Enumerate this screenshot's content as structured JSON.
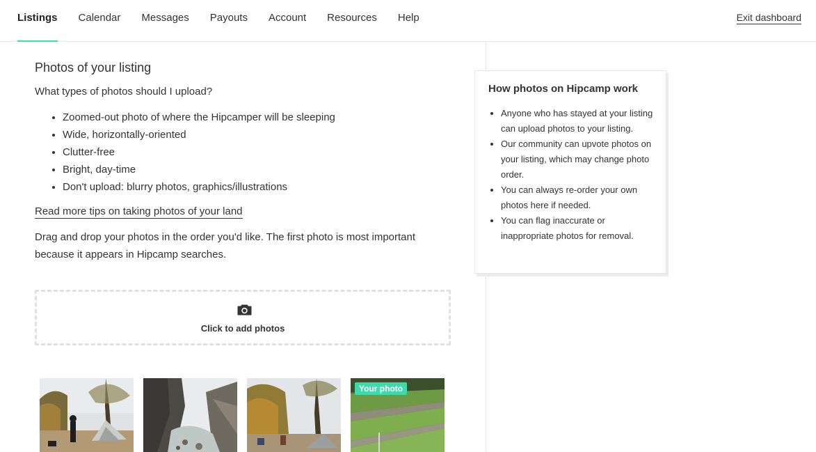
{
  "nav": {
    "tabs": [
      {
        "label": "Listings",
        "active": true
      },
      {
        "label": "Calendar"
      },
      {
        "label": "Messages"
      },
      {
        "label": "Payouts"
      },
      {
        "label": "Account"
      },
      {
        "label": "Resources"
      },
      {
        "label": "Help"
      }
    ],
    "exit_label": "Exit dashboard"
  },
  "main": {
    "title": "Photos of your listing",
    "question": "What types of photos should I upload?",
    "tips": [
      "Zoomed-out photo of where the Hipcamper will be sleeping",
      "Wide, horizontally-oriented",
      "Clutter-free",
      "Bright, day-time",
      "Don't upload: blurry photos, graphics/illustrations"
    ],
    "more_tips_link": "Read more tips on taking photos of your land",
    "instructions": "Drag and drop your photos in the order you'd like. The first photo is most important because it appears in Hipcamp searches.",
    "upload_label": "Click to add photos",
    "upload_icon": "camera-icon",
    "photos": [
      {
        "alt": "campsite-tent-with-people"
      },
      {
        "alt": "rocky-canyon-creek"
      },
      {
        "alt": "campsite-autumn-trees"
      },
      {
        "alt": "vegetable-garden-rows",
        "badge": "Your photo"
      }
    ]
  },
  "info": {
    "title": "How photos on Hipcamp work",
    "items": [
      "Anyone who has stayed at your listing can upload photos to your listing.",
      "Our community can upvote photos on your listing, which may change photo order.",
      "You can always re-order your own photos here if needed.",
      "You can flag inaccurate or inappropriate photos for removal."
    ]
  },
  "colors": {
    "accent": "#40d9ac",
    "text": "#333333",
    "border": "#e6e6e6"
  }
}
